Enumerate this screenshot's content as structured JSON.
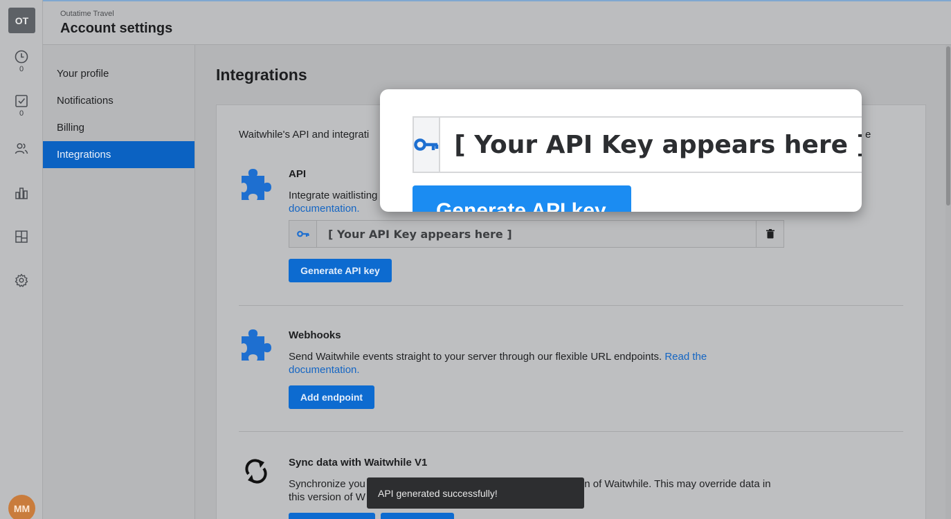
{
  "rail": {
    "logo": "OT",
    "items": [
      {
        "icon": "clock-icon",
        "count": "0"
      },
      {
        "icon": "checkbox-icon",
        "count": "0"
      },
      {
        "icon": "users-icon"
      },
      {
        "icon": "bar-chart-icon"
      },
      {
        "icon": "layout-icon"
      },
      {
        "icon": "gear-icon"
      }
    ],
    "avatar": "MM"
  },
  "header": {
    "org": "Outatime Travel",
    "title": "Account settings"
  },
  "subnav": {
    "items": [
      {
        "label": "Your profile"
      },
      {
        "label": "Notifications"
      },
      {
        "label": "Billing"
      },
      {
        "label": "Integrations",
        "active": true
      }
    ]
  },
  "main": {
    "title": "Integrations",
    "intro_start": "Waitwhile's API and integrati",
    "intro_tail": "e",
    "api": {
      "title": "API",
      "desc": "Integrate waitlisting",
      "link": "documentation.",
      "key_placeholder": "[ Your API Key appears here ]",
      "generate_label": "Generate API key"
    },
    "webhooks": {
      "title": "Webhooks",
      "desc": "Send Waitwhile events straight to your server through our flexible URL endpoints.",
      "link": "Read the documentation.",
      "add_label": "Add endpoint"
    },
    "sync": {
      "title": "Sync data with Waitwhile V1",
      "desc_a": "Synchronize you",
      "desc_b": "n of Waitwhile. This may override data in",
      "desc_c": "this version of W"
    }
  },
  "zoom": {
    "key_placeholder": "[ Your API Key appears here ]",
    "button_label": "Generate API key"
  },
  "toast": {
    "message": "API generated successfully!"
  },
  "colors": {
    "accent": "#0d6bd0",
    "puzzle": "#1e6fd0",
    "avatar": "#c97c3c"
  }
}
